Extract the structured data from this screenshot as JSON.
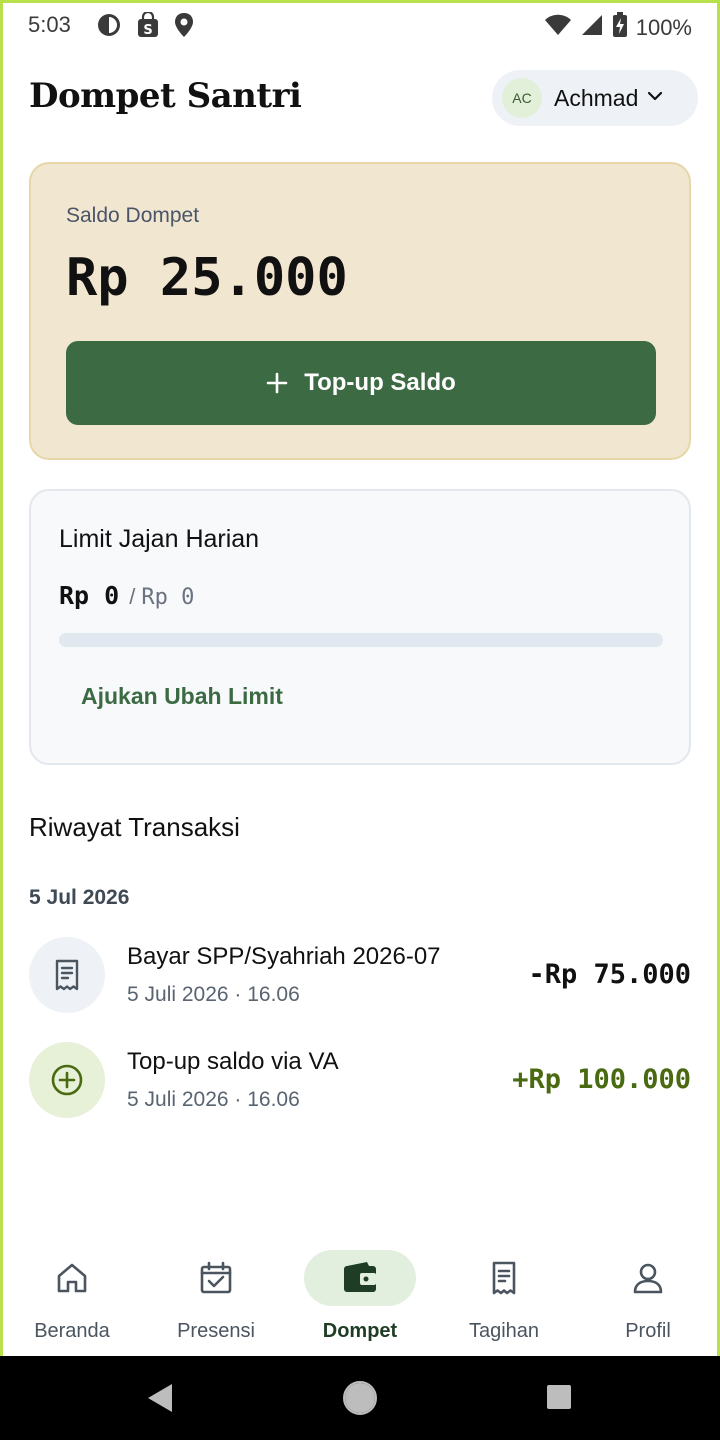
{
  "status_bar": {
    "time": "5:03",
    "battery": "100%",
    "left_icons": [
      "data-saver-icon",
      "shopping-bag-icon",
      "location-pin-icon"
    ],
    "right_icons": [
      "wifi-icon",
      "signal-icon",
      "battery-charging-icon"
    ]
  },
  "header": {
    "title": "Dompet Santri",
    "user_initials": "AC",
    "user_name": "Achmad"
  },
  "balance": {
    "label": "Saldo Dompet",
    "amount": "Rp 25.000",
    "topup_label": "Top-up Saldo"
  },
  "limit": {
    "title": "Limit Jajan Harian",
    "used": "Rp 0",
    "separator": "/",
    "max": "Rp 0",
    "progress_fraction": 0,
    "change_link": "Ajukan Ubah Limit"
  },
  "history": {
    "title": "Riwayat Transaksi",
    "groups": [
      {
        "date": "5 Jul 2026",
        "items": [
          {
            "title": "Bayar SPP/Syahriah 2026-07",
            "meta": "5 Juli 2026 · 16.06",
            "amount": "-Rp 75.000",
            "type": "debit",
            "icon": "receipt-icon"
          },
          {
            "title": "Top-up saldo via VA",
            "meta": "5 Juli 2026 · 16.06",
            "amount": "+Rp 100.000",
            "type": "credit",
            "icon": "plus-circle-icon"
          }
        ]
      }
    ]
  },
  "nav": {
    "items": [
      {
        "label": "Beranda",
        "icon": "home-icon",
        "active": false
      },
      {
        "label": "Presensi",
        "icon": "calendar-check-icon",
        "active": false
      },
      {
        "label": "Dompet",
        "icon": "wallet-icon",
        "active": true
      },
      {
        "label": "Tagihan",
        "icon": "receipt-icon",
        "active": false
      },
      {
        "label": "Profil",
        "icon": "user-icon",
        "active": false
      }
    ]
  },
  "colors": {
    "brand_green": "#3b6a43",
    "balance_card_bg": "#f1e7d1",
    "credit_amount": "#4a6a12",
    "debit_amount": "#111111",
    "frame_border": "#b8e04a"
  }
}
